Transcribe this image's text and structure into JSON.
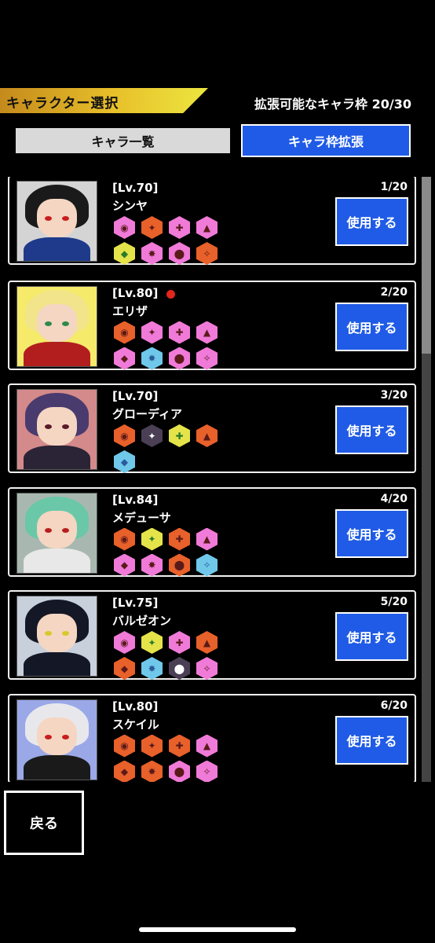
{
  "header": {
    "title": "キャラクター選択",
    "capacity": "拡張可能なキャラ枠 20/30"
  },
  "tabs": {
    "list_label": "キャラ一覧",
    "expand_label": "キャラ枠拡張"
  },
  "use_label": "使用する",
  "back_label": "戻る",
  "characters": [
    {
      "level": "[Lv.70]",
      "name": "シンヤ",
      "slot": "1/20",
      "new_badge": false,
      "portrait_bg": "#d4d4d4",
      "hair": "#1a1a1a",
      "eyes": "#c81e1e",
      "body": "#1f3a8a",
      "skills": [
        "pink",
        "orange",
        "pink",
        "pink",
        "yellow",
        "pink",
        "pink",
        "orange"
      ]
    },
    {
      "level": "[Lv.80]",
      "name": "エリザ",
      "slot": "2/20",
      "new_badge": true,
      "portrait_bg": "#f5ea6a",
      "hair": "#f1e48a",
      "eyes": "#2e8a4a",
      "body": "#b21e1e",
      "skills": [
        "orange",
        "pink",
        "pink",
        "pink",
        "pink",
        "blue",
        "pink",
        "pink"
      ]
    },
    {
      "level": "[Lv.70]",
      "name": "グローディア",
      "slot": "3/20",
      "new_badge": false,
      "portrait_bg": "#d48a8a",
      "hair": "#4a3b6e",
      "eyes": "#5a1a2a",
      "body": "#2a2436",
      "skills": [
        "orange",
        "dark",
        "yellow",
        "orange",
        "blue"
      ]
    },
    {
      "level": "[Lv.84]",
      "name": "メデューサ",
      "slot": "4/20",
      "new_badge": false,
      "portrait_bg": "#a8b8b0",
      "hair": "#6ac8a8",
      "eyes": "#b81e1e",
      "body": "#e8e8e8",
      "skills": [
        "orange",
        "yellow",
        "orange",
        "pink",
        "pink",
        "pink",
        "orange",
        "blue"
      ]
    },
    {
      "level": "[Lv.75]",
      "name": "バルゼオン",
      "slot": "5/20",
      "new_badge": false,
      "portrait_bg": "#c8d0dc",
      "hair": "#141826",
      "eyes": "#d8c82a",
      "body": "#141826",
      "skills": [
        "pink",
        "yellow",
        "pink",
        "orange",
        "orange",
        "blue",
        "dark",
        "pink"
      ]
    },
    {
      "level": "[Lv.80]",
      "name": "スケイル",
      "slot": "6/20",
      "new_badge": false,
      "portrait_bg": "#9aa8e8",
      "hair": "#e8e8ec",
      "eyes": "#c81e1e",
      "body": "#1a1a1a",
      "skills": [
        "orange",
        "orange",
        "orange",
        "pink",
        "orange",
        "orange",
        "pink",
        "pink"
      ]
    }
  ]
}
